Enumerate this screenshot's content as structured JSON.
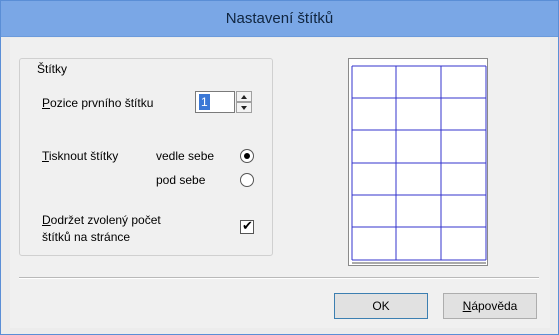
{
  "window": {
    "title": "Nastavení štítků"
  },
  "group": {
    "title": "Štítky"
  },
  "first_label": {
    "label_mnemonic": "P",
    "label_rest": "ozice prvního štítku",
    "value": "1"
  },
  "print_labels": {
    "label_mnemonic": "T",
    "label_rest": "isknout štítky",
    "options": [
      {
        "label": "vedle sebe",
        "selected": true
      },
      {
        "label": "pod sebe",
        "selected": false
      }
    ]
  },
  "keep_count": {
    "line1_mnemonic": "D",
    "line1_rest": "održet zvolený počet",
    "line2": "štítků na stránce",
    "checked": true
  },
  "preview": {
    "columns": 3,
    "rows": 6,
    "line_color": "#3333cc"
  },
  "buttons": {
    "ok": "OK",
    "help_mnemonic": "N",
    "help_rest": "ápověda"
  },
  "colors": {
    "titlebar": "#7aa7e6",
    "selection": "#3b78d6"
  }
}
